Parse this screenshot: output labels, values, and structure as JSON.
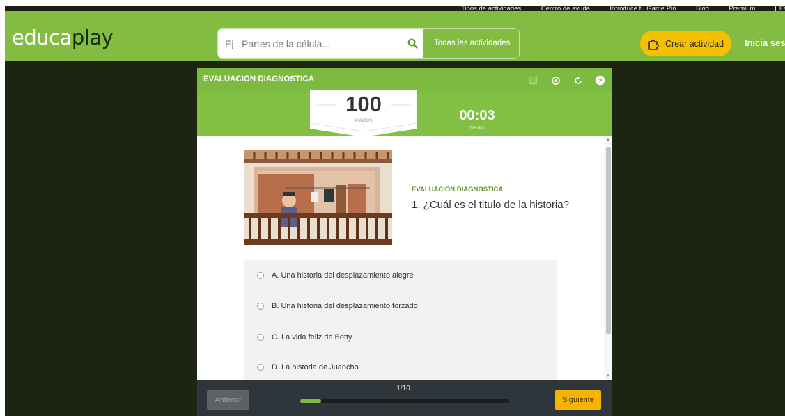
{
  "top_links": [
    "Tipos de actividades",
    "Centro de ayuda",
    "Introduce tu Game Pin",
    "Blog",
    "Premium"
  ],
  "language": "Español",
  "header": {
    "logo_main": "educa",
    "logo_sub": "play",
    "search_placeholder": "Ej.: Partes de la célula...",
    "all_activities": "Todas las actividades",
    "create_label": "Crear actividad",
    "login_label": "Inicia sesión"
  },
  "activity": {
    "title": "EVALUACIÓN DIAGNOSTICA",
    "tool_icons": [
      "fullscreen-icon",
      "podium-icon",
      "restart-icon",
      "help-icon"
    ],
    "score": "100",
    "score_label": "PUNTOS",
    "time": "00:03",
    "time_label": "TIEMPO",
    "question_category": "EVALUACIÓN DIAGNOSTICA",
    "question": "1. ¿Cuál es el titulo de la historia?",
    "answers": [
      "A. Una historia del desplazamiento alegre",
      "B. Una historia del desplazamiento forzado",
      "C. La vida feliz de Betty",
      "D. La historia de Juancho"
    ],
    "prev_label": "Anterior",
    "pager": "1/10",
    "progress": 0.1,
    "next_label": "Siguiente"
  },
  "colors": {
    "brand_green": "#82bc41",
    "accent_yellow": "#f5c000",
    "background_dark": "#1c2412",
    "footer_dark": "#2e353b"
  }
}
